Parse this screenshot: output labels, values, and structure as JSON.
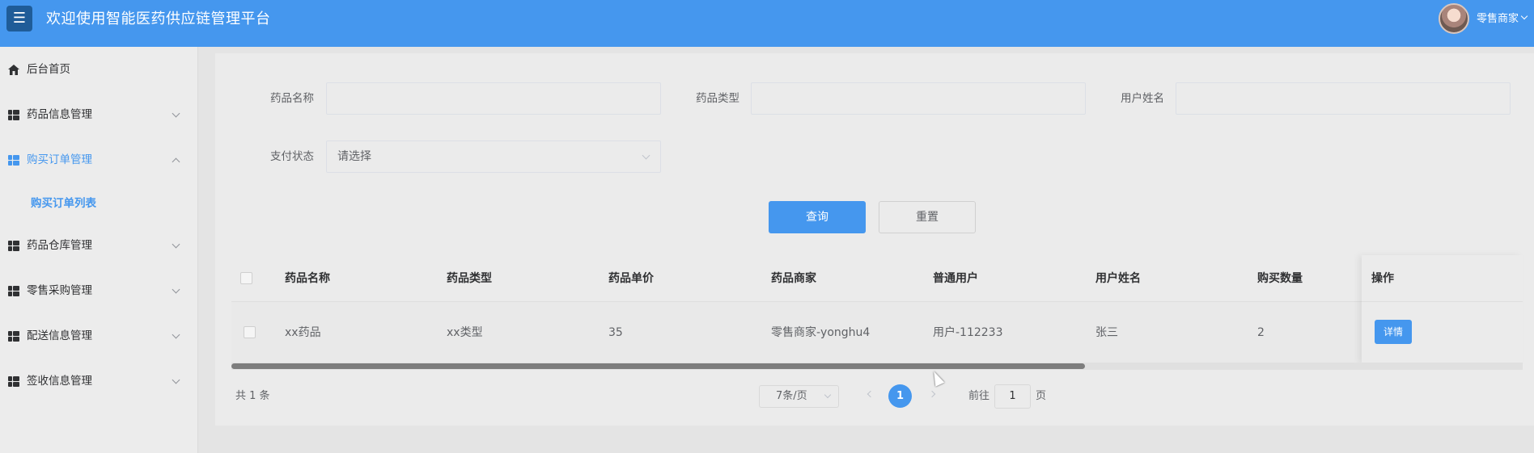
{
  "header": {
    "menu_icon": "☰",
    "title": "欢迎使用智能医药供应链管理平台",
    "user_name": "零售商家"
  },
  "sidebar": {
    "items": [
      {
        "label": "后台首页",
        "icon": "home-icon"
      },
      {
        "label": "药品信息管理",
        "icon": "grid-icon"
      },
      {
        "label": "购买订单管理",
        "icon": "grid-icon",
        "expanded": true
      },
      {
        "label": "药品仓库管理",
        "icon": "grid-icon"
      },
      {
        "label": "零售采购管理",
        "icon": "grid-icon"
      },
      {
        "label": "配送信息管理",
        "icon": "grid-icon"
      },
      {
        "label": "签收信息管理",
        "icon": "grid-icon"
      }
    ],
    "sub_item": "购买订单列表"
  },
  "search": {
    "drug_name_label": "药品名称",
    "drug_type_label": "药品类型",
    "user_name_label": "用户姓名",
    "pay_status_label": "支付状态",
    "pay_status_placeholder": "请选择",
    "query_label": "查询",
    "reset_label": "重置"
  },
  "table": {
    "columns": [
      "药品名称",
      "药品类型",
      "药品单价",
      "药品商家",
      "普通用户",
      "用户姓名",
      "购买数量",
      "操作"
    ],
    "rows": [
      {
        "drug_name": "xx药品",
        "drug_type": "xx类型",
        "price": "35",
        "merchant": "零售商家-yonghu4",
        "user": "用户-112233",
        "user_name": "张三",
        "quantity": "2",
        "action": "详情"
      }
    ]
  },
  "pagination": {
    "total": "共 1 条",
    "page_size": "7条/页",
    "current_page": "1",
    "goto_label": "前往",
    "goto_value": "1",
    "goto_suffix": "页"
  },
  "colors": {
    "primary": "#4597ee",
    "menu_button": "#1f5c98"
  }
}
